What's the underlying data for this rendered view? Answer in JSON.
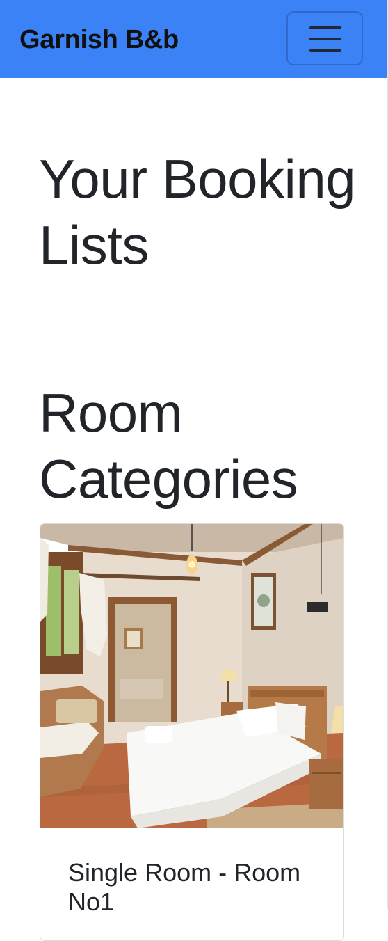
{
  "navbar": {
    "brand": "Garnish B&b",
    "toggler_icon": "hamburger-menu-icon",
    "background_color": "#3b82f6"
  },
  "main": {
    "booking_heading": "Your Booking Lists",
    "categories_heading": "Room Categories",
    "rooms": [
      {
        "title": "Single Room - Room No1",
        "image": "bedroom-photo"
      }
    ]
  }
}
